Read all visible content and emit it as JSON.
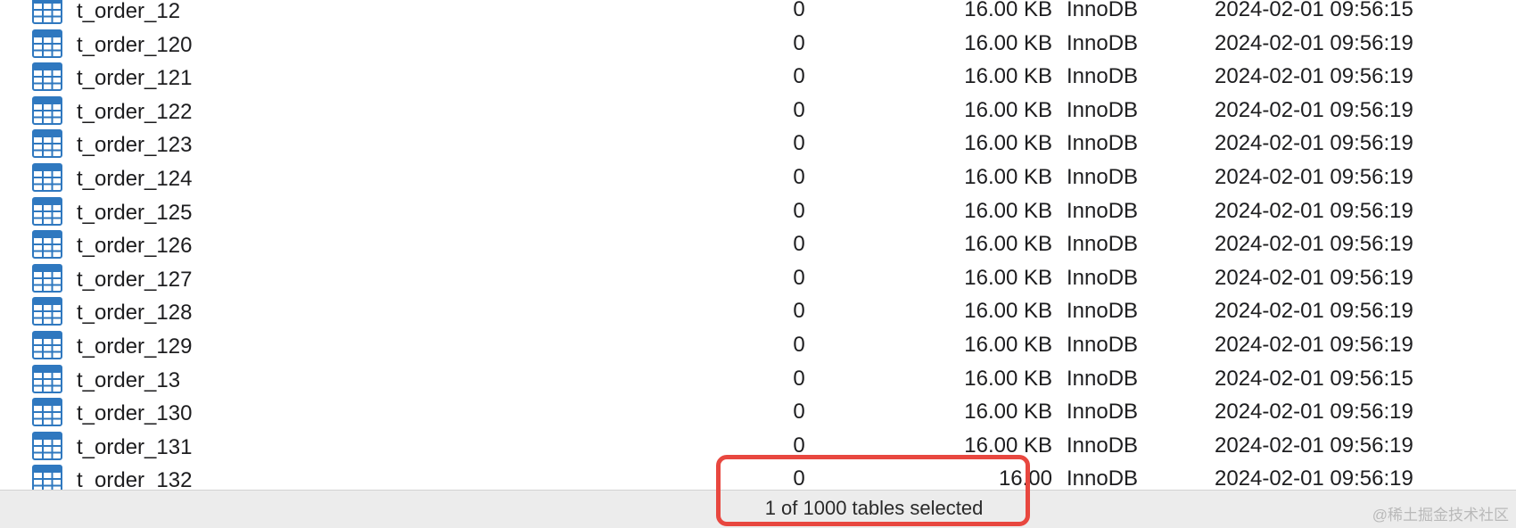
{
  "tables": [
    {
      "name": "t_order_12",
      "rows": "0",
      "size": "16.00 KB",
      "engine": "InnoDB",
      "modified": "2024-02-01 09:56:15"
    },
    {
      "name": "t_order_120",
      "rows": "0",
      "size": "16.00 KB",
      "engine": "InnoDB",
      "modified": "2024-02-01 09:56:19"
    },
    {
      "name": "t_order_121",
      "rows": "0",
      "size": "16.00 KB",
      "engine": "InnoDB",
      "modified": "2024-02-01 09:56:19"
    },
    {
      "name": "t_order_122",
      "rows": "0",
      "size": "16.00 KB",
      "engine": "InnoDB",
      "modified": "2024-02-01 09:56:19"
    },
    {
      "name": "t_order_123",
      "rows": "0",
      "size": "16.00 KB",
      "engine": "InnoDB",
      "modified": "2024-02-01 09:56:19"
    },
    {
      "name": "t_order_124",
      "rows": "0",
      "size": "16.00 KB",
      "engine": "InnoDB",
      "modified": "2024-02-01 09:56:19"
    },
    {
      "name": "t_order_125",
      "rows": "0",
      "size": "16.00 KB",
      "engine": "InnoDB",
      "modified": "2024-02-01 09:56:19"
    },
    {
      "name": "t_order_126",
      "rows": "0",
      "size": "16.00 KB",
      "engine": "InnoDB",
      "modified": "2024-02-01 09:56:19"
    },
    {
      "name": "t_order_127",
      "rows": "0",
      "size": "16.00 KB",
      "engine": "InnoDB",
      "modified": "2024-02-01 09:56:19"
    },
    {
      "name": "t_order_128",
      "rows": "0",
      "size": "16.00 KB",
      "engine": "InnoDB",
      "modified": "2024-02-01 09:56:19"
    },
    {
      "name": "t_order_129",
      "rows": "0",
      "size": "16.00 KB",
      "engine": "InnoDB",
      "modified": "2024-02-01 09:56:19"
    },
    {
      "name": "t_order_13",
      "rows": "0",
      "size": "16.00 KB",
      "engine": "InnoDB",
      "modified": "2024-02-01 09:56:15"
    },
    {
      "name": "t_order_130",
      "rows": "0",
      "size": "16.00 KB",
      "engine": "InnoDB",
      "modified": "2024-02-01 09:56:19"
    },
    {
      "name": "t_order_131",
      "rows": "0",
      "size": "16.00 KB",
      "engine": "InnoDB",
      "modified": "2024-02-01 09:56:19"
    },
    {
      "name": "t_order_132",
      "rows": "0",
      "size": "16.00",
      "engine": "InnoDB",
      "modified": "2024-02-01 09:56:19"
    }
  ],
  "table_icon": "table-grid-icon",
  "status_bar": {
    "text": "1 of 1000 tables selected"
  },
  "annotation": {
    "color": "#e8473f"
  },
  "watermark": "@稀土掘金技术社区",
  "colors": {
    "icon_blue": "#2f78bf",
    "status_bar_bg": "#ececec"
  }
}
